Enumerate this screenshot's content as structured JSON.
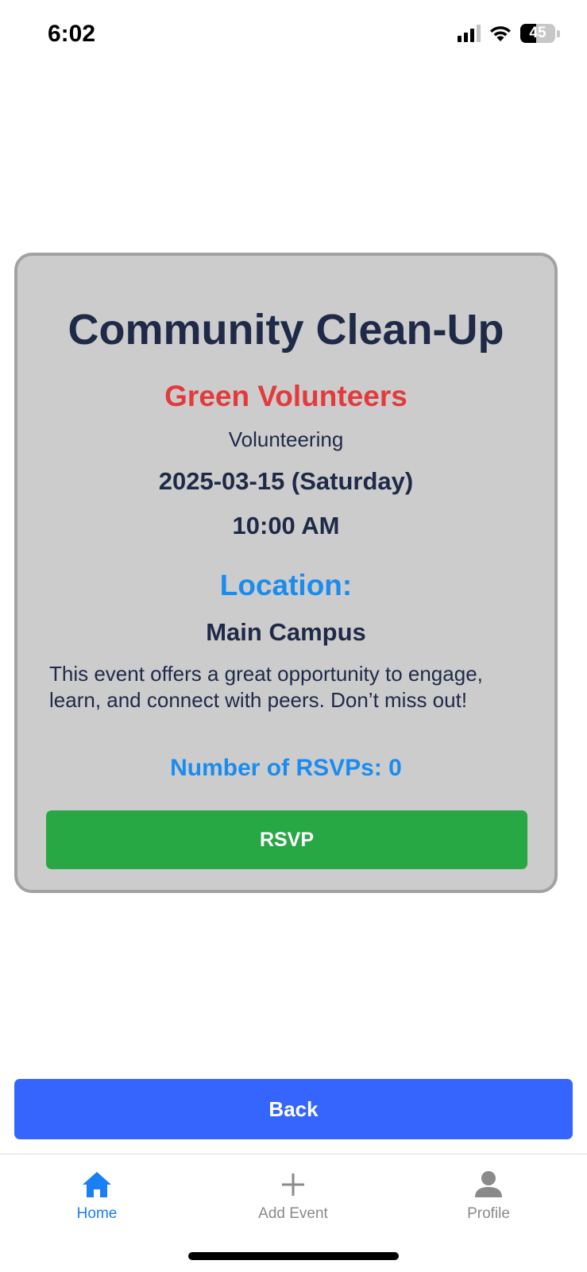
{
  "status_bar": {
    "time": "6:02",
    "battery_level": "45",
    "battery_fraction": 0.45,
    "icons": [
      "cellular-signal-icon",
      "wifi-icon",
      "battery-icon"
    ]
  },
  "event": {
    "title": "Community Clean-Up",
    "organizer": "Green Volunteers",
    "category": "Volunteering",
    "date": "2025-03-15 (Saturday)",
    "time": "10:00 AM",
    "location_heading": "Location:",
    "location": "Main Campus",
    "description": "This event offers a great opportunity to engage, learn, and connect with peers. Don’t miss out!",
    "rsvp_count_text": "Number of RSVPs: 0",
    "rsvp_button_label": "RSVP"
  },
  "back_button_label": "Back",
  "tab_bar": {
    "tabs": [
      {
        "label": "Home",
        "icon": "home-icon",
        "active": true
      },
      {
        "label": "Add Event",
        "icon": "plus-icon",
        "active": false
      },
      {
        "label": "Profile",
        "icon": "person-icon",
        "active": false
      }
    ]
  },
  "colors": {
    "title": "#1f2a48",
    "organizer": "#e33a3d",
    "accent_blue": "#1a8cf0",
    "rsvp_green": "#28a745",
    "back_blue": "#3565fd",
    "card_background": "#cccccc",
    "tab_active": "#1a7ef5",
    "tab_inactive": "#8a8a8a"
  }
}
